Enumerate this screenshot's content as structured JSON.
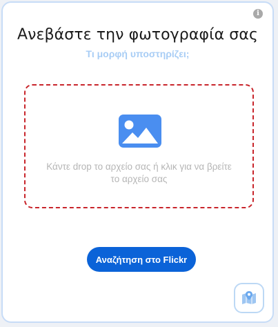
{
  "dialog": {
    "title": "Ανεβάστε την φωτογραφία σας",
    "formats_link": "Τι μορφή υποστηρίζει;",
    "info_icon": "info-icon",
    "info_glyph": "i"
  },
  "dropzone": {
    "icon": "image-icon",
    "text_line1": "Κάντε drop το αρχείο σας ή κλικ για να βρείτε",
    "text_line2": "το αρχείο σας"
  },
  "actions": {
    "flickr_label": "Αναζήτηση στο Flickr",
    "map_icon": "map-pin-icon"
  },
  "colors": {
    "accent": "#0b63d8",
    "dropzone_border": "#c8242a",
    "link": "#a8cdf5",
    "icon_blue": "#4a8ef0"
  }
}
